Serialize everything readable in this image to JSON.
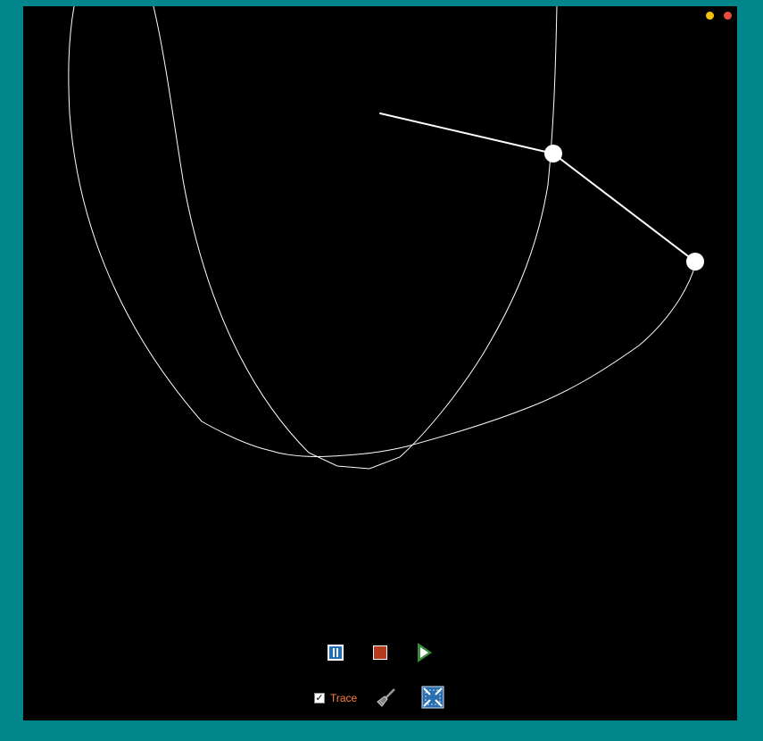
{
  "window": {
    "background_color": "#000000",
    "frame_color": "#00868b",
    "minimize_color": "#f4c20d",
    "close_color": "#e74c3c"
  },
  "controls": {
    "pause_icon": "pause-icon",
    "stop_icon": "stop-icon",
    "play_icon": "play-icon",
    "trace_label": "Trace",
    "trace_checked": true,
    "trace_check_glyph": "✓",
    "trace_label_color": "#ff7f3f",
    "clear_icon": "broom-icon",
    "fit_icon": "fit-to-screen-icon"
  }
}
